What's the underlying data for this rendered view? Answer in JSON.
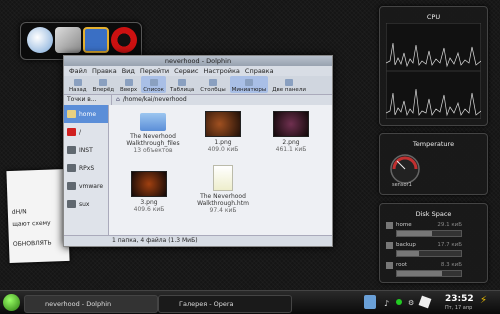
{
  "dolphin": {
    "title": "neverhood - Dolphin",
    "menu": [
      "Файл",
      "Правка",
      "Вид",
      "Перейти",
      "Сервис",
      "Настройка",
      "Справка"
    ],
    "toolbar": [
      "Назад",
      "Вперёд",
      "Вверх",
      "Список",
      "Таблица",
      "Столбцы",
      "Миниатюры",
      "Две панели"
    ],
    "places_header": "Точки в...",
    "location": "/home/kai/neverhood",
    "places": [
      "home",
      "/",
      "INST",
      "RPxS",
      "vmware",
      "sux"
    ],
    "files": [
      {
        "name": "The Neverhood Walkthrough_files",
        "info": "13 объектов"
      },
      {
        "name": "1.png",
        "info": "409.0 киБ"
      },
      {
        "name": "2.png",
        "info": "461.1 киБ"
      },
      {
        "name": "3.png",
        "info": "409.6 киБ"
      },
      {
        "name": "The Neverhood Walkthrough.htm",
        "info": "97.4 киБ"
      }
    ],
    "status": "1 папка, 4 файла (1.3 МиБ)"
  },
  "note": {
    "line1": "dH/N",
    "line2": "щают схему",
    "line3": "ОБНОВЛЯТЬ"
  },
  "widgets": {
    "cpu": {
      "title": "CPU"
    },
    "temperature": {
      "title": "Temperature",
      "sensor": "sensor1"
    },
    "disk": {
      "title": "Disk Space",
      "rows": [
        {
          "name": "home",
          "size": "29.1 киБ",
          "used": 0.55
        },
        {
          "name": "backup",
          "size": "17.7 киБ",
          "used": 0.35
        },
        {
          "name": "root",
          "size": "8.3 киБ",
          "used": 0.7
        }
      ]
    }
  },
  "taskbar": {
    "tasks": [
      "neverhood - Dolphin",
      "Галерея - Opera"
    ],
    "time": "23:52",
    "date": "Пт, 17 апр"
  },
  "colors": {
    "accent": "#5b8ed8",
    "opera": "#cc1111"
  }
}
